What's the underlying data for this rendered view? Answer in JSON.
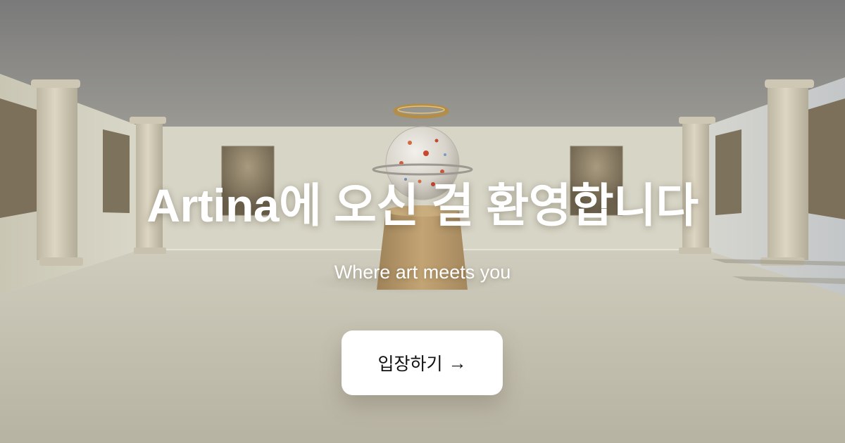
{
  "hero": {
    "title": "Artina에 오신 걸 환영합니다",
    "subtitle": "Where art meets you"
  },
  "cta": {
    "label": "입장하기",
    "arrow": "→"
  },
  "colors": {
    "ceiling": "#7b7b7b",
    "back_wall": "#d6d4c4",
    "floor": "#bdb9a8",
    "pillar": "#cfc9b6",
    "frame": "#7a6e58",
    "pedestal": "#b39467",
    "halo": "#b8924a",
    "button_bg": "#ffffff",
    "text": "#ffffff"
  }
}
